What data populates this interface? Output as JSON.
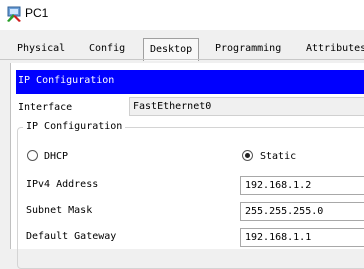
{
  "window": {
    "title": "PC1",
    "icon": "pc-window-icon"
  },
  "tabs": [
    {
      "label": "Physical",
      "active": false
    },
    {
      "label": "Config",
      "active": false
    },
    {
      "label": "Desktop",
      "active": true
    },
    {
      "label": "Programming",
      "active": false
    },
    {
      "label": "Attributes",
      "active": false
    }
  ],
  "header": {
    "title": "IP Configuration",
    "color": "#0000ff"
  },
  "interface": {
    "label": "Interface",
    "value": "FastEthernet0"
  },
  "ip_config": {
    "legend": "IP Configuration",
    "mode_options": [
      {
        "label": "DHCP",
        "selected": false
      },
      {
        "label": "Static",
        "selected": true
      }
    ],
    "fields": [
      {
        "label": "IPv4 Address",
        "value": "192.168.1.2"
      },
      {
        "label": "Subnet Mask",
        "value": "255.255.255.0"
      },
      {
        "label": "Default Gateway",
        "value": "192.168.1.1"
      }
    ]
  }
}
